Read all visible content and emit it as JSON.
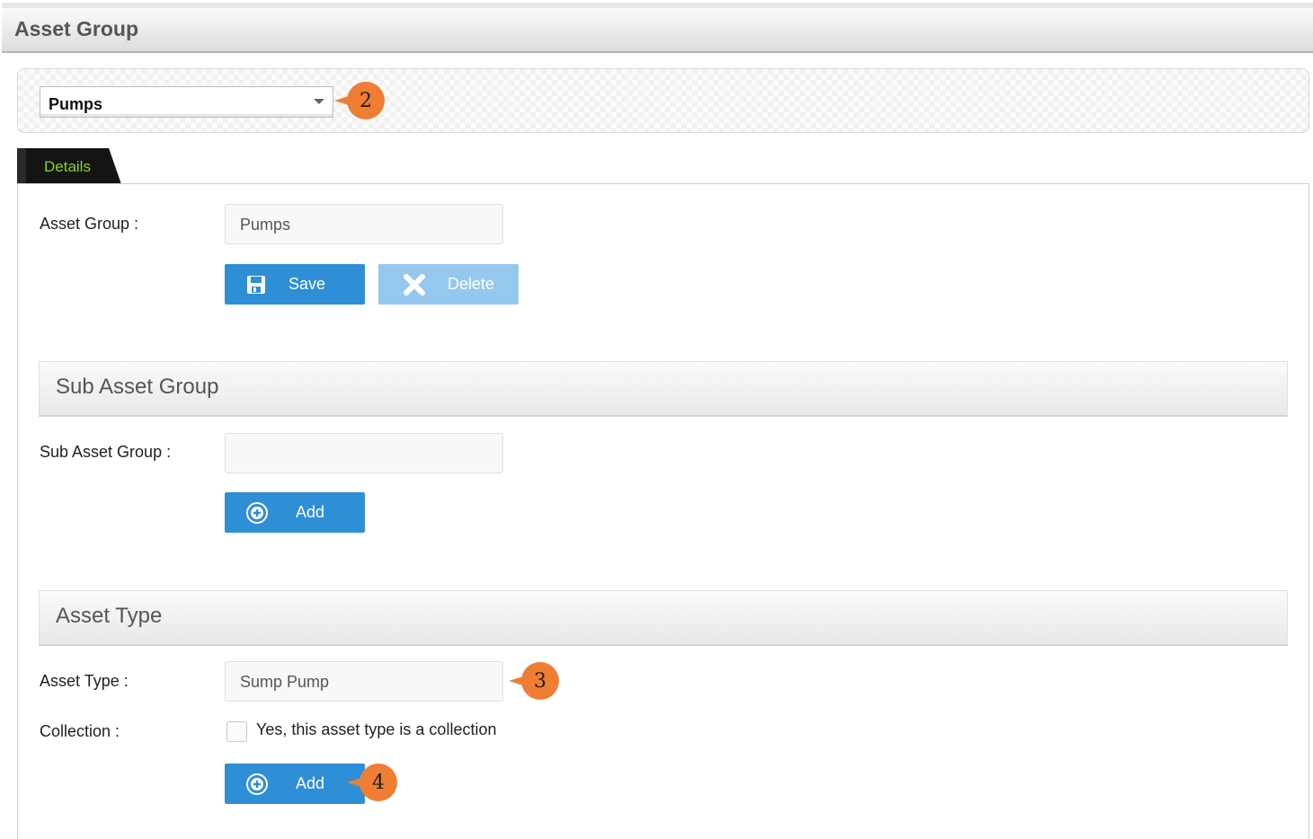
{
  "header": {
    "title": "Asset Group"
  },
  "selector": {
    "value": "Pumps"
  },
  "tabs": [
    {
      "label": "Details"
    }
  ],
  "asset_group": {
    "label": "Asset Group :",
    "value": "Pumps",
    "save_label": "Save",
    "delete_label": "Delete"
  },
  "sub_asset_group": {
    "section_title": "Sub Asset Group",
    "label": "Sub Asset Group :",
    "value": "",
    "add_label": "Add"
  },
  "asset_type": {
    "section_title": "Asset Type",
    "label": "Asset Type :",
    "value": "Sump Pump",
    "collection_label": "Collection :",
    "collection_checkbox_text": "Yes, this asset type is a collection",
    "collection_checked": false,
    "add_label": "Add"
  },
  "callouts": [
    "2",
    "3",
    "4"
  ],
  "colors": {
    "primary_button": "#2e8fd6",
    "disabled_button": "#94c8ef",
    "callout": "#ef7d34",
    "tab_background": "#141414",
    "tab_text": "#8bd51c"
  }
}
